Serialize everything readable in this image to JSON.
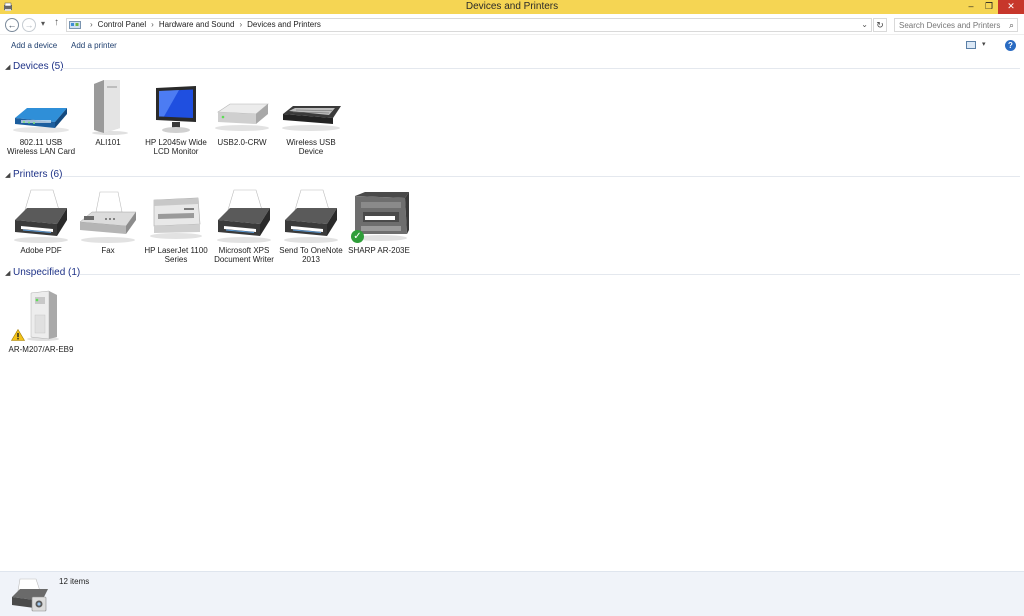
{
  "window": {
    "title": "Devices and Printers",
    "minimize": "–",
    "maximize": "❐",
    "close": "✕"
  },
  "nav": {
    "back": "←",
    "forward": "→",
    "recent": "▾",
    "up": "↑",
    "breadcrumbs": [
      "Control Panel",
      "Hardware and Sound",
      "Devices and Printers"
    ],
    "separator": "›",
    "dropdown": "⌄",
    "refresh": "↻",
    "search_placeholder": "Search Devices and Printers",
    "search_icon": "⌕"
  },
  "commands": {
    "add_device": "Add a device",
    "add_printer": "Add a printer",
    "view_dropdown": "▾",
    "help": "?"
  },
  "groups": {
    "devices": {
      "title": "Devices (5)",
      "items": [
        {
          "label": "802.11 USB Wireless LAN Card",
          "icon": "wireless-router-icon"
        },
        {
          "label": "ALI101",
          "icon": "tower-pc-icon"
        },
        {
          "label": "HP L2045w Wide LCD Monitor",
          "icon": "monitor-icon"
        },
        {
          "label": "USB2.0-CRW",
          "icon": "drive-icon"
        },
        {
          "label": "Wireless USB Device",
          "icon": "keyboard-icon"
        }
      ]
    },
    "printers": {
      "title": "Printers (6)",
      "items": [
        {
          "label": "Adobe PDF",
          "icon": "printer-icon"
        },
        {
          "label": "Fax",
          "icon": "fax-icon"
        },
        {
          "label": "HP LaserJet 1100 Series",
          "icon": "laser-printer-icon"
        },
        {
          "label": "Microsoft XPS Document Writer",
          "icon": "printer-icon"
        },
        {
          "label": "Send To OneNote 2013",
          "icon": "printer-icon"
        },
        {
          "label": "SHARP AR-203E",
          "icon": "multifunction-printer-icon",
          "default": true
        }
      ]
    },
    "unspecified": {
      "title": "Unspecified (1)",
      "items": [
        {
          "label": "AR-M207/AR-EB9",
          "icon": "generic-device-icon",
          "warning": true
        }
      ]
    }
  },
  "status": {
    "count": "12 items"
  },
  "colors": {
    "titlebar": "#f5d553",
    "close": "#c7372b",
    "group_title": "#1e3287",
    "statusbar": "#f0f3f9"
  }
}
